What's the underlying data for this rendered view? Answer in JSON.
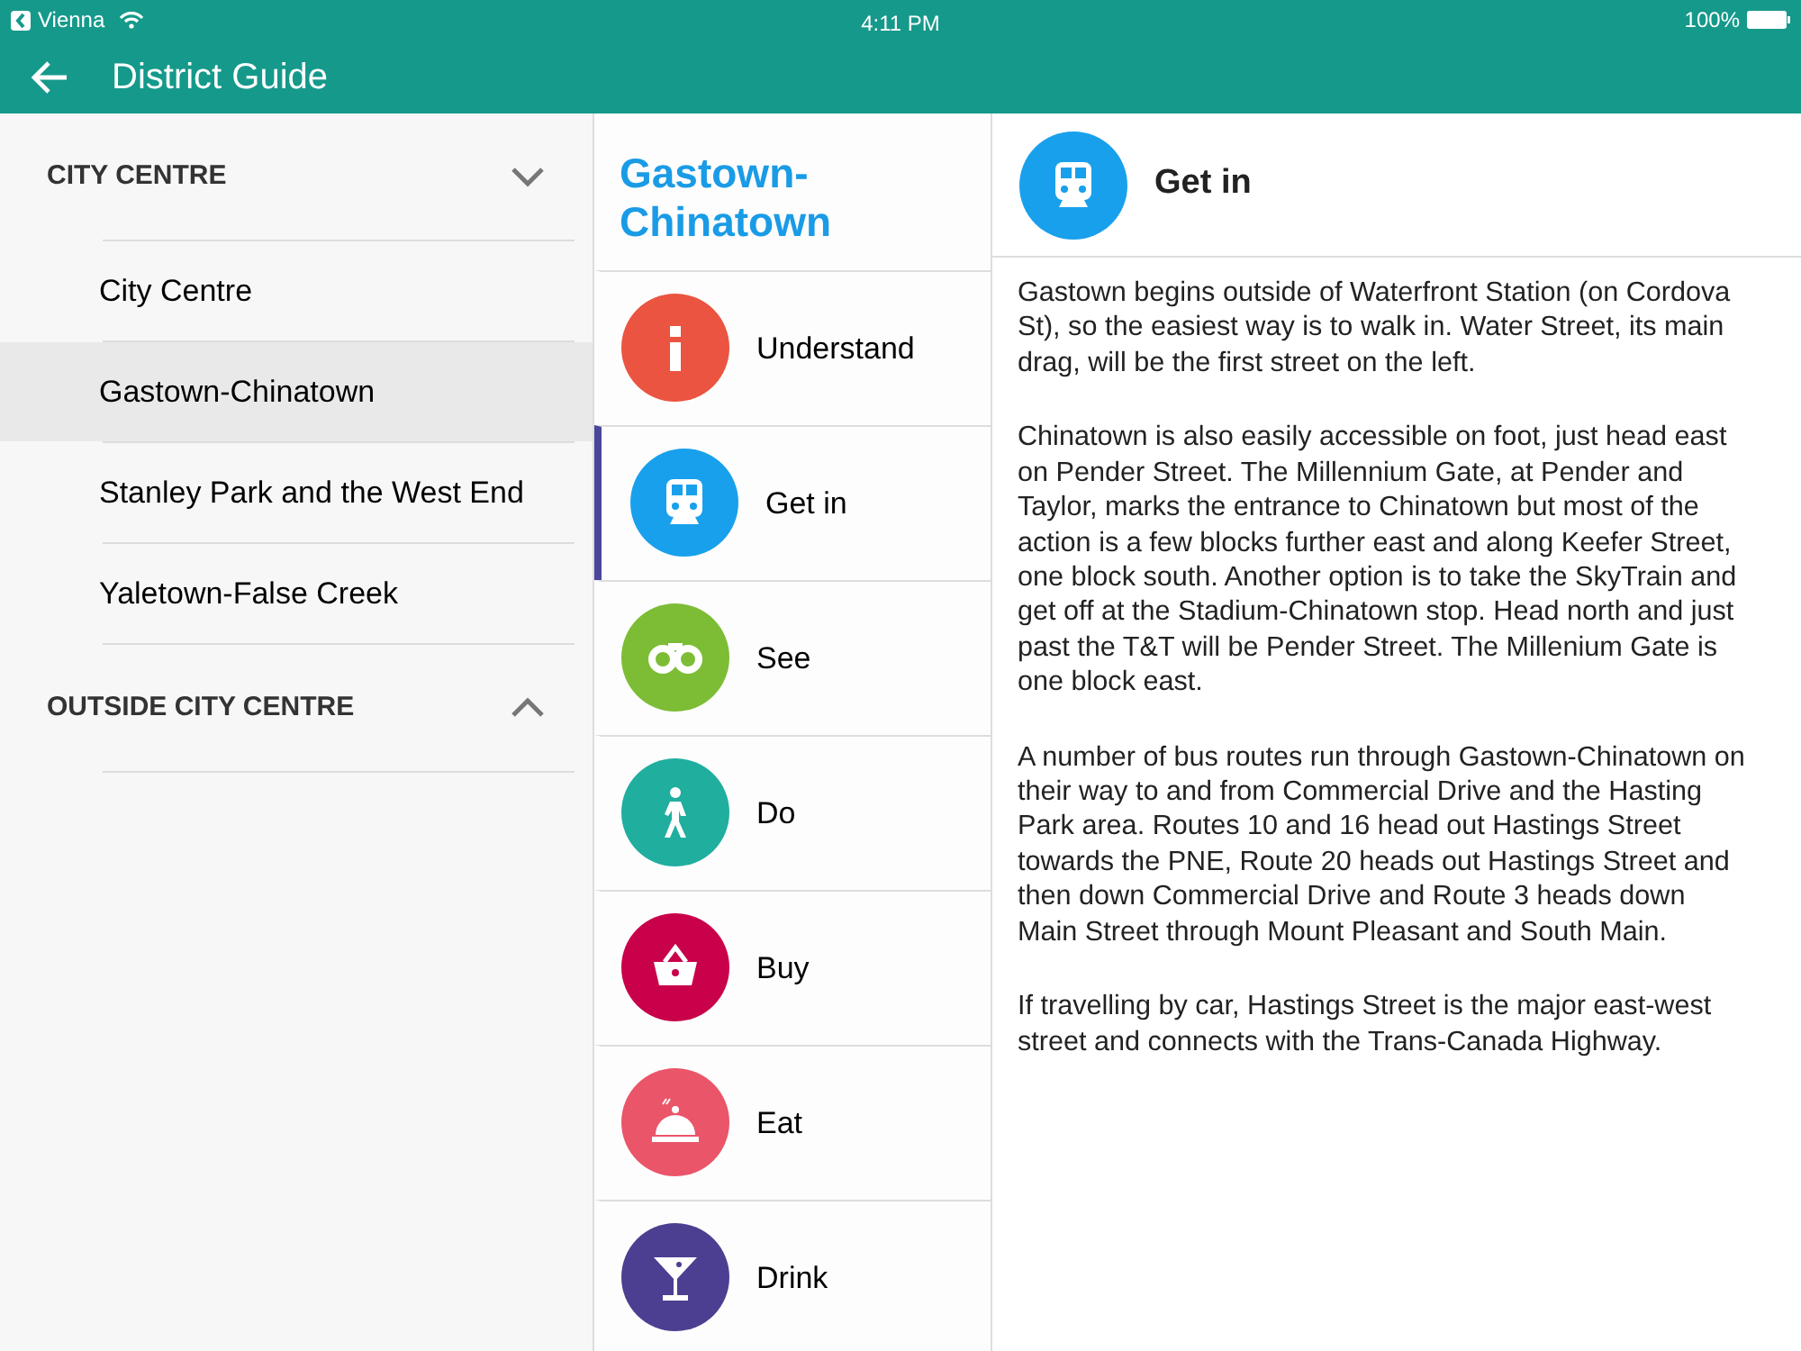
{
  "status_bar": {
    "back_app": "Vienna",
    "time": "4:11 PM",
    "battery": "100%"
  },
  "header": {
    "title": "District Guide"
  },
  "sidebar": {
    "sections": [
      {
        "title": "CITY CENTRE",
        "expanded": true,
        "items": [
          {
            "label": "City Centre",
            "selected": false
          },
          {
            "label": "Gastown-Chinatown",
            "selected": true
          },
          {
            "label": "Stanley Park and the West End",
            "selected": false
          },
          {
            "label": "Yaletown-False Creek",
            "selected": false
          }
        ]
      },
      {
        "title": "OUTSIDE CITY CENTRE",
        "expanded": false
      }
    ]
  },
  "topics": {
    "title": "Gastown-Chinatown",
    "items": [
      {
        "kind": "info",
        "label": "Understand",
        "color": "#ea5440",
        "selected": false
      },
      {
        "kind": "train",
        "label": "Get in",
        "color": "#18a0ec",
        "selected": true
      },
      {
        "kind": "binoculars",
        "label": "See",
        "color": "#7cbd35",
        "selected": false
      },
      {
        "kind": "walk",
        "label": "Do",
        "color": "#20ae9f",
        "selected": false
      },
      {
        "kind": "basket",
        "label": "Buy",
        "color": "#c9004a",
        "selected": false
      },
      {
        "kind": "cloche",
        "label": "Eat",
        "color": "#ea5569",
        "selected": false
      },
      {
        "kind": "cocktail",
        "label": "Drink",
        "color": "#4c3f91",
        "selected": false
      }
    ]
  },
  "detail": {
    "kind": "train",
    "color": "#18a0ec",
    "title": "Get in",
    "paragraphs": [
      "Gastown begins outside of Waterfront Station (on Cordova St), so the easiest way is to walk in. Water Street, its main drag, will be the first street on the left.",
      "Chinatown is also easily accessible on foot, just head east on Pender Street. The Millennium Gate, at Pender and Taylor, marks the entrance to Chinatown but most of the action is a few blocks further east and along Keefer Street, one block south. Another option is to take the SkyTrain and get off at the Stadium-Chinatown stop. Head north and just past the T&T will be Pender Street. The Millenium Gate is one block east.",
      "A number of bus routes run through Gastown-Chinatown on their way to and from Commercial Drive and the Hasting Park area. Routes 10 and 16 head out Hastings Street towards the PNE, Route 20 heads out Hastings Street and then down Commercial Drive and Route 3 heads down Main Street through Mount Pleasant and South Main.",
      "If travelling by car, Hastings Street is the major east-west street and connects with the Trans-Canada Highway."
    ]
  }
}
